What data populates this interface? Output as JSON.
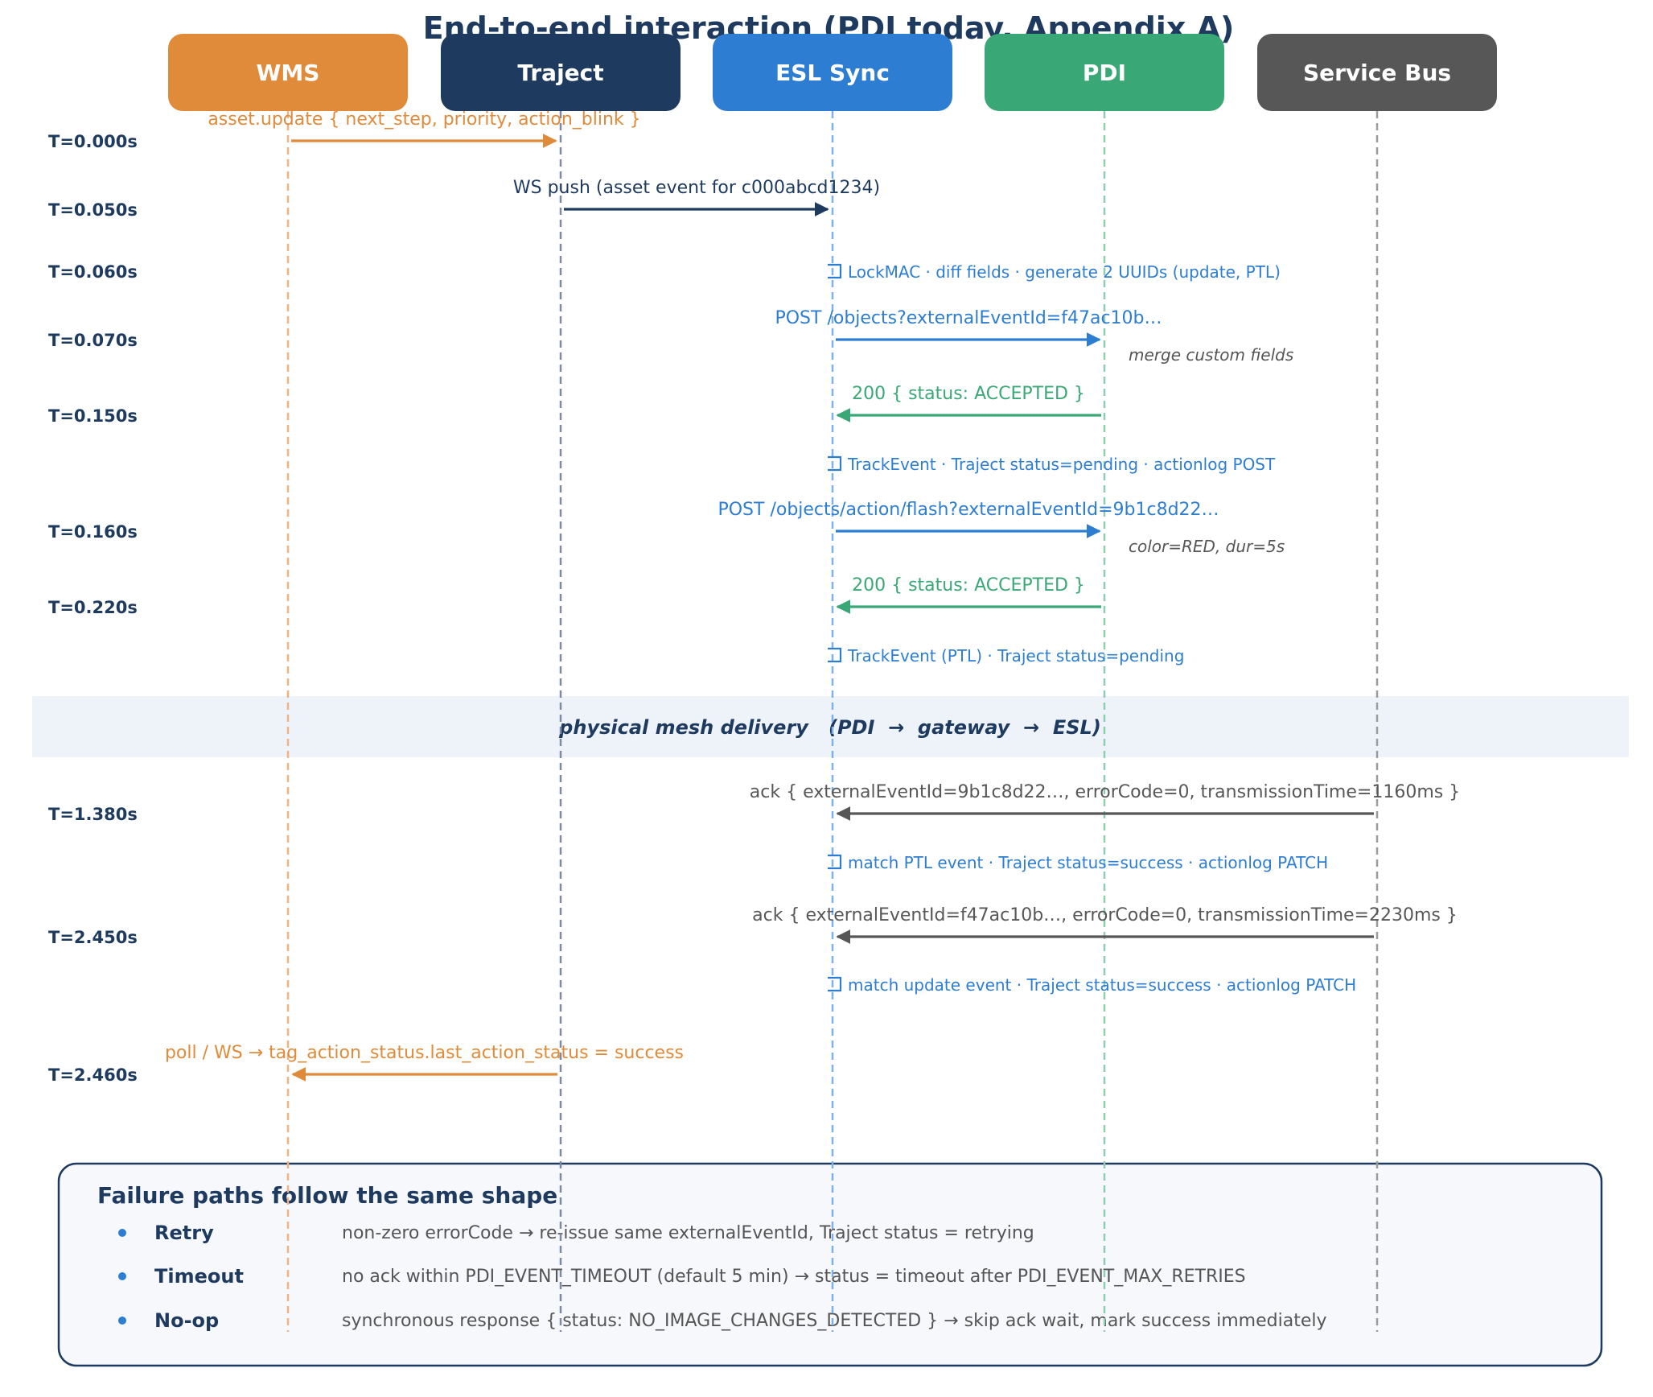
{
  "title": "End-to-end interaction (PDI today, Appendix A)",
  "colors": {
    "wms": "#e08b3a",
    "traject": "#1e3a5f",
    "esl_sync": "#2d7dd2",
    "pdi": "#3aa876",
    "service_bus": "#575757",
    "note": "#2d7dd2",
    "muted": "#555555"
  },
  "actors": [
    {
      "id": "wms",
      "label": "WMS",
      "color": "#e08b3a"
    },
    {
      "id": "traject",
      "label": "Traject",
      "color": "#1e3a5f"
    },
    {
      "id": "esl_sync",
      "label": "ESL Sync",
      "color": "#2d7dd2"
    },
    {
      "id": "pdi",
      "label": "PDI",
      "color": "#3aa876"
    },
    {
      "id": "service_bus",
      "label": "Service Bus",
      "color": "#575757"
    }
  ],
  "events": [
    {
      "kind": "message",
      "time": "T=0.000s",
      "from": 0,
      "to": 1,
      "label": "asset.update  { next_step, priority, action_blink }",
      "color": "#e08b3a"
    },
    {
      "kind": "message",
      "time": "T=0.050s",
      "from": 1,
      "to": 2,
      "label": "WS push  (asset event for c000abcd1234)",
      "color": "#1e3a5f"
    },
    {
      "kind": "note",
      "time": "T=0.060s",
      "actor": 2,
      "label": "LockMAC · diff fields · generate 2 UUIDs (update, PTL)"
    },
    {
      "kind": "message",
      "time": "T=0.070s",
      "from": 2,
      "to": 3,
      "label": "POST /objects?externalEventId=f47ac10b…",
      "color": "#2d7dd2",
      "side_note": "merge custom fields"
    },
    {
      "kind": "message",
      "time": "T=0.150s",
      "from": 3,
      "to": 2,
      "label": "200  { status: ACCEPTED }",
      "color": "#3aa876"
    },
    {
      "kind": "note",
      "time": "",
      "actor": 2,
      "label": "TrackEvent · Traject status=pending · actionlog POST"
    },
    {
      "kind": "message",
      "time": "T=0.160s",
      "from": 2,
      "to": 3,
      "label": "POST /objects/action/flash?externalEventId=9b1c8d22…",
      "color": "#2d7dd2",
      "side_note": "color=RED, dur=5s"
    },
    {
      "kind": "message",
      "time": "T=0.220s",
      "from": 3,
      "to": 2,
      "label": "200  { status: ACCEPTED }",
      "color": "#3aa876"
    },
    {
      "kind": "note",
      "time": "",
      "actor": 2,
      "label": "TrackEvent (PTL) · Traject status=pending"
    },
    {
      "kind": "band",
      "label": "physical mesh delivery   (PDI  →  gateway  →  ESL)"
    },
    {
      "kind": "message",
      "time": "T=1.380s",
      "from": 4,
      "to": 2,
      "label": "ack  { externalEventId=9b1c8d22…, errorCode=0, transmissionTime=1160ms }",
      "color": "#575757"
    },
    {
      "kind": "note",
      "time": "",
      "actor": 2,
      "label": "match PTL event · Traject status=success · actionlog PATCH"
    },
    {
      "kind": "message",
      "time": "T=2.450s",
      "from": 4,
      "to": 2,
      "label": "ack  { externalEventId=f47ac10b…, errorCode=0, transmissionTime=2230ms }",
      "color": "#575757"
    },
    {
      "kind": "note",
      "time": "",
      "actor": 2,
      "label": "match update event · Traject status=success · actionlog PATCH"
    },
    {
      "kind": "message",
      "time": "T=2.460s",
      "from": 1,
      "to": 0,
      "label": "poll / WS  →  tag_action_status.last_action_status = success",
      "color": "#e08b3a"
    }
  ],
  "failure_box": {
    "title": "Failure paths follow the same shape",
    "items": [
      {
        "name": "Retry",
        "desc": "non-zero errorCode → re-issue same externalEventId, Traject status = retrying"
      },
      {
        "name": "Timeout",
        "desc": "no ack within PDI_EVENT_TIMEOUT (default 5 min) → status = timeout after PDI_EVENT_MAX_RETRIES"
      },
      {
        "name": "No-op",
        "desc": "synchronous response { status: NO_IMAGE_CHANGES_DETECTED } → skip ack wait, mark success immediately"
      }
    ]
  }
}
